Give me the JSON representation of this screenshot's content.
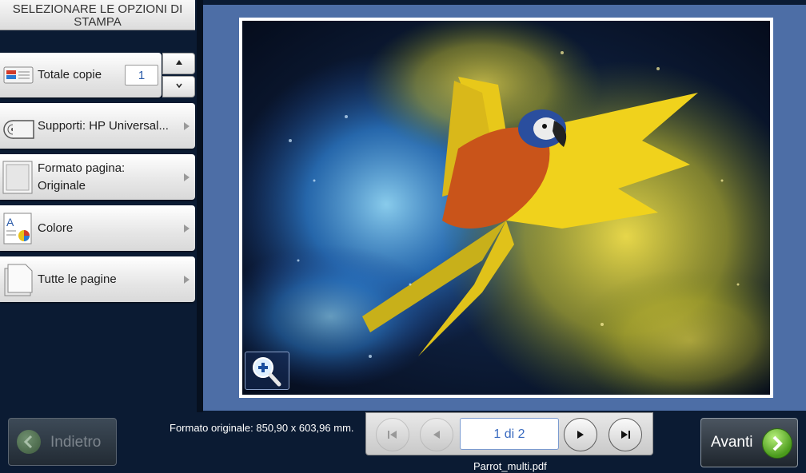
{
  "header": {
    "title": "SELEZIONARE LE OPZIONI DI STAMPA"
  },
  "options": {
    "copies": {
      "label": "Totale copie",
      "value": "1"
    },
    "media": {
      "label": "Supporti: HP Universal..."
    },
    "page_size": {
      "label_line1": "Formato pagina:",
      "label_line2": "Originale"
    },
    "color": {
      "label": "Colore"
    },
    "pages": {
      "label": "Tutte le pagine"
    }
  },
  "footer": {
    "back_label": "Indietro",
    "next_label": "Avanti",
    "format_text": "Formato originale: 850,90 x 603,96 mm.",
    "page_indicator": "1 di 2",
    "file_name": "Parrot_multi.pdf"
  },
  "colors": {
    "background": "#0b1b33",
    "preview_bg": "#4d6ea6",
    "accent_green": "#4a9a1c"
  }
}
